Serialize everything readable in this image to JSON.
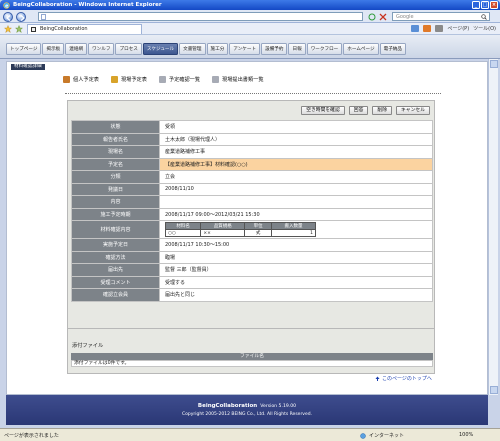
{
  "window": {
    "title": "BeingCollaboration - Windows Internet Explorer"
  },
  "browser": {
    "search_placeholder": "Google",
    "tab_title": "BeingCollaboration",
    "tools": {
      "page": "ページ(P)",
      "tool": "ツール(O)"
    }
  },
  "nav": {
    "items": [
      "トップページ",
      "掲示板",
      "連絡網",
      "ワンルフ",
      "プロセス",
      "スケジュール",
      "文書管理",
      "施工分",
      "アンケート",
      "設備予約",
      "日報",
      "ワークフロー",
      "ホームページ",
      "電子納品"
    ],
    "active_index": 5
  },
  "breadcrumb": "材料確認詳細",
  "links": [
    {
      "label": "個人予定表",
      "icon": "person-icon",
      "color": "#c87a2a"
    },
    {
      "label": "現場予定表",
      "icon": "group-icon",
      "color": "#d8a32a"
    },
    {
      "label": "予定確認一覧",
      "icon": "list-icon",
      "color": "#8a8f9c"
    },
    {
      "label": "現場提出書類一覧",
      "icon": "docs-icon",
      "color": "#8a8f9c"
    }
  ],
  "buttons": {
    "check_free": "空き時間を確認",
    "reply": "回答",
    "delete": "削除",
    "cancel": "キャンセル"
  },
  "details": {
    "status": {
      "label": "状態",
      "value": "受領"
    },
    "reporter": {
      "label": "報告者氏名",
      "value": "土木太郎（現場代理人）"
    },
    "site": {
      "label": "現場名",
      "value": "産業道路補修工事"
    },
    "schedule": {
      "label": "予定名",
      "value": "【産業道路補修工事】材料確認(○○)"
    },
    "category": {
      "label": "分類",
      "value": "立会"
    },
    "report_date": {
      "label": "発議日",
      "value": "2008/11/10"
    },
    "content": {
      "label": "内容",
      "value": ""
    },
    "period": {
      "label": "施工予定時期",
      "value": "2008/11/17 09:00～2012/03/21 15:30"
    },
    "materials": {
      "label": "材料確認内容",
      "headers": [
        "材料名",
        "品質規格",
        "単位",
        "搬入数量"
      ],
      "rows": [
        [
          "○○",
          "××",
          "式",
          "1"
        ]
      ]
    },
    "planned_date": {
      "label": "実施予定日",
      "value": "2008/11/17 10:30～15:00"
    },
    "method": {
      "label": "確認方法",
      "value": "臨場"
    },
    "submit_to": {
      "label": "届出先",
      "value": "監督 三郎（監督員）"
    },
    "comment": {
      "label": "受理コメント",
      "value": "受理する"
    },
    "attendee": {
      "label": "確認立会員",
      "value": "届出先と同じ"
    }
  },
  "attachments": {
    "title": "添付ファイル",
    "header": "ファイル名",
    "empty_text": "添付ファイルは0件です。"
  },
  "to_top": "このページのトップへ",
  "footer": {
    "brand": "BeingCollaboration",
    "version": "Version 5.19.00",
    "copyright": "Copyright 2005-2012 BEING Co., Ltd. All Rights Reserved."
  },
  "status": {
    "text": "ページが表示されました",
    "zone": "インターネット",
    "zoom": "100%"
  }
}
